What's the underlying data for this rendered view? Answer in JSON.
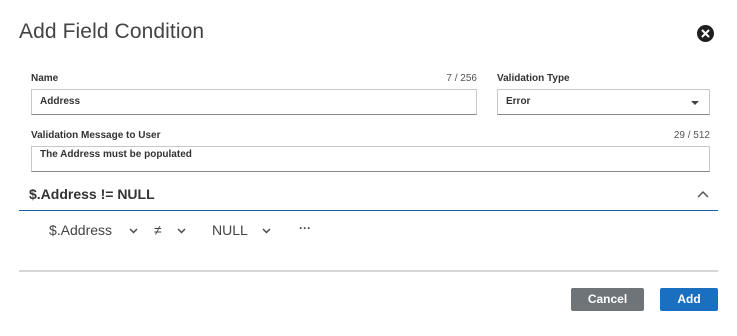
{
  "dialog": {
    "title": "Add Field Condition",
    "close_icon": "close-circle-icon"
  },
  "form": {
    "name": {
      "label": "Name",
      "counter": "7 / 256",
      "value": "Address"
    },
    "validation_type": {
      "label": "Validation Type",
      "value": "Error"
    },
    "message": {
      "label": "Validation Message to User",
      "counter": "29 / 512",
      "value": "The Address must be populated"
    }
  },
  "condition": {
    "header": "$.Address != NULL",
    "field": "$.Address",
    "operator": "≠",
    "value": "NULL",
    "more": "···"
  },
  "footer": {
    "cancel_label": "Cancel",
    "add_label": "Add"
  },
  "colors": {
    "accent": "#1a6fc0",
    "cancel": "#6f7479",
    "section_border": "#1a5fa0"
  }
}
